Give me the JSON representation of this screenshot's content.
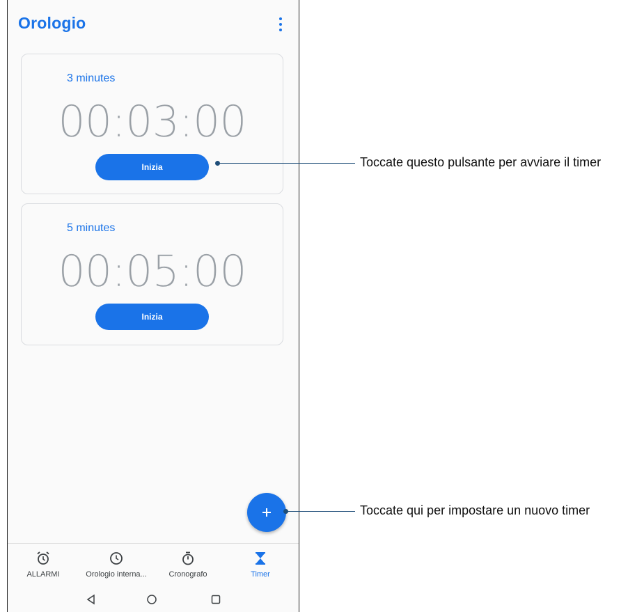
{
  "app": {
    "title": "Orologio"
  },
  "timers": [
    {
      "label": "3 minutes",
      "time": "00:03:00",
      "button_label": "Inizia"
    },
    {
      "label": "5 minutes",
      "time": "00:05:00",
      "button_label": "Inizia"
    }
  ],
  "fab": {
    "icon": "plus-icon"
  },
  "bottom_nav": [
    {
      "label": "ALLARMI",
      "icon": "alarm-icon",
      "active": false
    },
    {
      "label": "Orologio interna...",
      "icon": "clock-icon",
      "active": false
    },
    {
      "label": "Cronografo",
      "icon": "stopwatch-icon",
      "active": false
    },
    {
      "label": "Timer",
      "icon": "hourglass-icon",
      "active": true
    }
  ],
  "system_nav": [
    {
      "icon": "back-icon"
    },
    {
      "icon": "home-icon"
    },
    {
      "icon": "recents-icon"
    }
  ],
  "callouts": {
    "start_timer": "Toccate questo pulsante per avviare il timer",
    "new_timer": "Toccate qui per impostare un nuovo timer"
  },
  "colors": {
    "accent": "#1a73e8",
    "callout": "#1f4e79"
  }
}
